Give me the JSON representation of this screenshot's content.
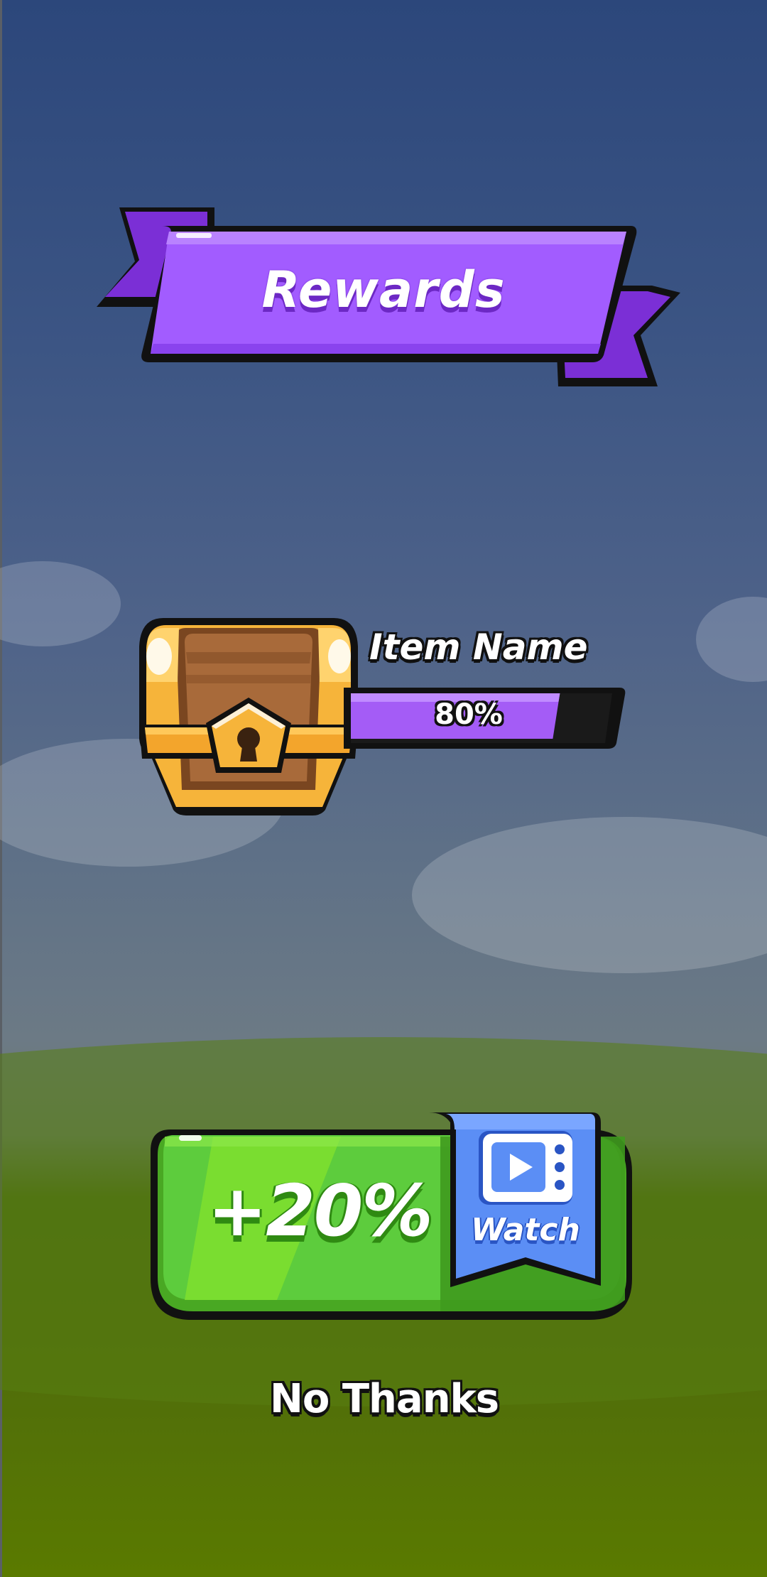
{
  "header": {
    "title": "Rewards"
  },
  "reward_item": {
    "name": "Item Name",
    "progress": 0.8,
    "progress_label": "80%",
    "icon": "treasure-chest-icon"
  },
  "ad_offer": {
    "bonus_label": "+20%",
    "watch_label": "Watch",
    "icon": "video-play-icon"
  },
  "dismiss": {
    "label": "No Thanks"
  },
  "colors": {
    "ribbon": "#a15cff",
    "ribbon_dark": "#7a34e0",
    "progress_fill": "#a45cf6",
    "button_green": "#5ccc3c",
    "watch_blue": "#5b8ef5",
    "chest_gold": "#f6b43a",
    "chest_wood": "#a86a3a"
  }
}
